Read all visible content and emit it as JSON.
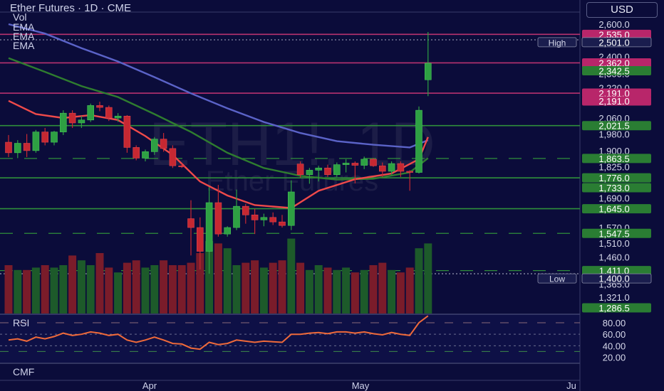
{
  "header": {
    "title": "Ether Futures · 1D · CME",
    "currency_button": "USD",
    "indicator_labels": [
      "Vol",
      "EMA",
      "EMA",
      "EMA"
    ]
  },
  "watermark": {
    "symbol": "ETH1!, 1D",
    "name": "Ether Futures"
  },
  "colors": {
    "background": "#0b0c3a",
    "up": "#2e8b3a",
    "down": "#b8262e",
    "ema_fast": "#ef4a4a",
    "ema_mid": "#2f7d2f",
    "ema_slow": "#5b63c8",
    "rsi_line": "#ef6a3a"
  },
  "price_axis": {
    "ticks": [
      "2,600.0",
      "2,400.0",
      "2,300.0",
      "2,220.0",
      "2,060.0",
      "1,980.0",
      "1,900.0",
      "1,825.0",
      "1,690.0",
      "1,570.0",
      "1,510.0",
      "1,460.0",
      "1,365.0",
      "1,321.0"
    ],
    "level_tags": [
      {
        "value": "2,535.0",
        "kind": "magenta"
      },
      {
        "value": "2,501.0",
        "kind": "high",
        "label": "High"
      },
      {
        "value": "2,362.0",
        "kind": "magenta"
      },
      {
        "value": "2,342.5",
        "kind": "green"
      },
      {
        "value": "2,191.0",
        "kind": "magenta"
      },
      {
        "value": "2,191.0",
        "kind": "magenta"
      },
      {
        "value": "2,021.5",
        "kind": "green"
      },
      {
        "value": "1,863.5",
        "kind": "green"
      },
      {
        "value": "1,776.0",
        "kind": "green"
      },
      {
        "value": "1,733.0",
        "kind": "green"
      },
      {
        "value": "1,645.0",
        "kind": "green"
      },
      {
        "value": "1,547.5",
        "kind": "green"
      },
      {
        "value": "1,411.0",
        "kind": "green"
      },
      {
        "value": "1,400.0",
        "kind": "low",
        "label": "Low"
      },
      {
        "value": "1,286.5",
        "kind": "green"
      }
    ]
  },
  "rsi_panel": {
    "label": "RSI",
    "ticks": [
      "80.00",
      "60.00",
      "40.00",
      "20.00"
    ]
  },
  "cmf_panel": {
    "label": "CMF"
  },
  "time_axis": {
    "labels": [
      "Apr",
      "May",
      "Ju"
    ]
  },
  "chart_data": {
    "type": "candlestick",
    "candles": [
      {
        "o": 1940,
        "h": 1975,
        "l": 1870,
        "c": 1890
      },
      {
        "o": 1890,
        "h": 1950,
        "l": 1865,
        "c": 1935
      },
      {
        "o": 1935,
        "h": 1980,
        "l": 1870,
        "c": 1900
      },
      {
        "o": 1900,
        "h": 2000,
        "l": 1890,
        "c": 1990
      },
      {
        "o": 1990,
        "h": 2010,
        "l": 1925,
        "c": 1940
      },
      {
        "o": 1940,
        "h": 1995,
        "l": 1925,
        "c": 1990
      },
      {
        "o": 1990,
        "h": 2100,
        "l": 1975,
        "c": 2085
      },
      {
        "o": 2085,
        "h": 2100,
        "l": 2010,
        "c": 2035
      },
      {
        "o": 2035,
        "h": 2070,
        "l": 2010,
        "c": 2050
      },
      {
        "o": 2050,
        "h": 2135,
        "l": 2040,
        "c": 2125
      },
      {
        "o": 2125,
        "h": 2145,
        "l": 2095,
        "c": 2115
      },
      {
        "o": 2115,
        "h": 2125,
        "l": 2045,
        "c": 2060
      },
      {
        "o": 2060,
        "h": 2085,
        "l": 2040,
        "c": 2070
      },
      {
        "o": 2070,
        "h": 2075,
        "l": 1890,
        "c": 1915
      },
      {
        "o": 1915,
        "h": 1925,
        "l": 1855,
        "c": 1865
      },
      {
        "o": 1865,
        "h": 1905,
        "l": 1850,
        "c": 1895
      },
      {
        "o": 1895,
        "h": 1965,
        "l": 1880,
        "c": 1955
      },
      {
        "o": 1955,
        "h": 1985,
        "l": 1895,
        "c": 1910
      },
      {
        "o": 1910,
        "h": 1925,
        "l": 1820,
        "c": 1830
      },
      {
        "o": 1830,
        "h": 1840,
        "l": 1820,
        "c": 1825
      },
      {
        "o": 1605,
        "h": 1680,
        "l": 1465,
        "c": 1570
      },
      {
        "o": 1570,
        "h": 1610,
        "l": 1415,
        "c": 1480
      },
      {
        "o": 1480,
        "h": 1735,
        "l": 1400,
        "c": 1670
      },
      {
        "o": 1670,
        "h": 1745,
        "l": 1535,
        "c": 1545
      },
      {
        "o": 1545,
        "h": 1575,
        "l": 1535,
        "c": 1570
      },
      {
        "o": 1570,
        "h": 1725,
        "l": 1560,
        "c": 1655
      },
      {
        "o": 1655,
        "h": 1665,
        "l": 1585,
        "c": 1620
      },
      {
        "o": 1620,
        "h": 1645,
        "l": 1545,
        "c": 1600
      },
      {
        "o": 1600,
        "h": 1625,
        "l": 1575,
        "c": 1610
      },
      {
        "o": 1610,
        "h": 1630,
        "l": 1580,
        "c": 1592
      },
      {
        "o": 1592,
        "h": 1620,
        "l": 1570,
        "c": 1578
      },
      {
        "o": 1578,
        "h": 1765,
        "l": 1560,
        "c": 1715
      },
      {
        "o": 1838,
        "h": 1850,
        "l": 1778,
        "c": 1790
      },
      {
        "o": 1790,
        "h": 1820,
        "l": 1750,
        "c": 1810
      },
      {
        "o": 1810,
        "h": 1830,
        "l": 1760,
        "c": 1820
      },
      {
        "o": 1820,
        "h": 1835,
        "l": 1780,
        "c": 1790
      },
      {
        "o": 1790,
        "h": 1845,
        "l": 1780,
        "c": 1835
      },
      {
        "o": 1835,
        "h": 1860,
        "l": 1800,
        "c": 1842
      },
      {
        "o": 1842,
        "h": 1850,
        "l": 1752,
        "c": 1832
      },
      {
        "o": 1832,
        "h": 1872,
        "l": 1815,
        "c": 1860
      },
      {
        "o": 1860,
        "h": 1865,
        "l": 1825,
        "c": 1830
      },
      {
        "o": 1830,
        "h": 1845,
        "l": 1780,
        "c": 1805
      },
      {
        "o": 1805,
        "h": 1850,
        "l": 1790,
        "c": 1840
      },
      {
        "o": 1840,
        "h": 1850,
        "l": 1780,
        "c": 1805
      },
      {
        "o": 1805,
        "h": 1810,
        "l": 1720,
        "c": 1800
      },
      {
        "o": 1800,
        "h": 2120,
        "l": 1795,
        "c": 2100
      },
      {
        "o": 2265,
        "h": 2550,
        "l": 2175,
        "c": 2360
      }
    ],
    "volume": [
      40,
      36,
      36,
      38,
      40,
      38,
      40,
      48,
      44,
      40,
      50,
      38,
      34,
      42,
      44,
      38,
      40,
      44,
      40,
      40,
      42,
      50,
      60,
      58,
      54,
      40,
      42,
      44,
      38,
      42,
      44,
      62,
      42,
      36,
      40,
      38,
      36,
      38,
      34,
      36,
      40,
      42,
      36,
      34,
      38,
      54,
      58
    ],
    "ema_fast": [
      {
        "i": 0,
        "v": 2150
      },
      {
        "i": 3,
        "v": 2080
      },
      {
        "i": 6,
        "v": 2060
      },
      {
        "i": 9,
        "v": 2075
      },
      {
        "i": 12,
        "v": 2050
      },
      {
        "i": 15,
        "v": 1970
      },
      {
        "i": 18,
        "v": 1880
      },
      {
        "i": 21,
        "v": 1760
      },
      {
        "i": 24,
        "v": 1700
      },
      {
        "i": 27,
        "v": 1660
      },
      {
        "i": 31,
        "v": 1648
      },
      {
        "i": 34,
        "v": 1720
      },
      {
        "i": 38,
        "v": 1770
      },
      {
        "i": 42,
        "v": 1795
      },
      {
        "i": 45,
        "v": 1860
      },
      {
        "i": 46,
        "v": 1965
      }
    ],
    "ema_mid": [
      {
        "i": 0,
        "v": 2390
      },
      {
        "i": 4,
        "v": 2310
      },
      {
        "i": 8,
        "v": 2230
      },
      {
        "i": 12,
        "v": 2170
      },
      {
        "i": 16,
        "v": 2080
      },
      {
        "i": 20,
        "v": 1990
      },
      {
        "i": 24,
        "v": 1890
      },
      {
        "i": 28,
        "v": 1820
      },
      {
        "i": 32,
        "v": 1785
      },
      {
        "i": 36,
        "v": 1768
      },
      {
        "i": 40,
        "v": 1772
      },
      {
        "i": 44,
        "v": 1800
      },
      {
        "i": 46,
        "v": 1865
      }
    ],
    "ema_slow": [
      {
        "i": 0,
        "v": 2600
      },
      {
        "i": 4,
        "v": 2540
      },
      {
        "i": 8,
        "v": 2450
      },
      {
        "i": 12,
        "v": 2370
      },
      {
        "i": 16,
        "v": 2280
      },
      {
        "i": 20,
        "v": 2190
      },
      {
        "i": 24,
        "v": 2110
      },
      {
        "i": 28,
        "v": 2040
      },
      {
        "i": 32,
        "v": 1985
      },
      {
        "i": 36,
        "v": 1945
      },
      {
        "i": 40,
        "v": 1928
      },
      {
        "i": 44,
        "v": 1915
      },
      {
        "i": 46,
        "v": 1950
      }
    ],
    "rsi": [
      50,
      52,
      48,
      55,
      52,
      56,
      62,
      58,
      60,
      64,
      62,
      58,
      60,
      50,
      46,
      50,
      55,
      50,
      44,
      43,
      36,
      34,
      46,
      42,
      44,
      50,
      48,
      46,
      48,
      47,
      46,
      60,
      60,
      62,
      63,
      61,
      64,
      64,
      62,
      64,
      61,
      59,
      63,
      60,
      58,
      80,
      92
    ],
    "horizontal_levels": [
      {
        "value": 2535,
        "color": "magenta",
        "style": "solid"
      },
      {
        "value": 2501,
        "color": "gray",
        "style": "dotted"
      },
      {
        "value": 2362,
        "color": "magenta",
        "style": "solid"
      },
      {
        "value": 2191,
        "color": "magenta",
        "style": "solid"
      },
      {
        "value": 2021.5,
        "color": "green",
        "style": "solid"
      },
      {
        "value": 1863.5,
        "color": "green",
        "style": "dashed"
      },
      {
        "value": 1776,
        "color": "green",
        "style": "solid"
      },
      {
        "value": 1645,
        "color": "green",
        "style": "solid"
      },
      {
        "value": 1547.5,
        "color": "green",
        "style": "dashed"
      },
      {
        "value": 1411,
        "color": "green",
        "style": "dashed"
      },
      {
        "value": 1400,
        "color": "gray",
        "style": "dotted"
      }
    ],
    "y_scale": "log",
    "ylim": [
      1286.5,
      2700
    ]
  }
}
